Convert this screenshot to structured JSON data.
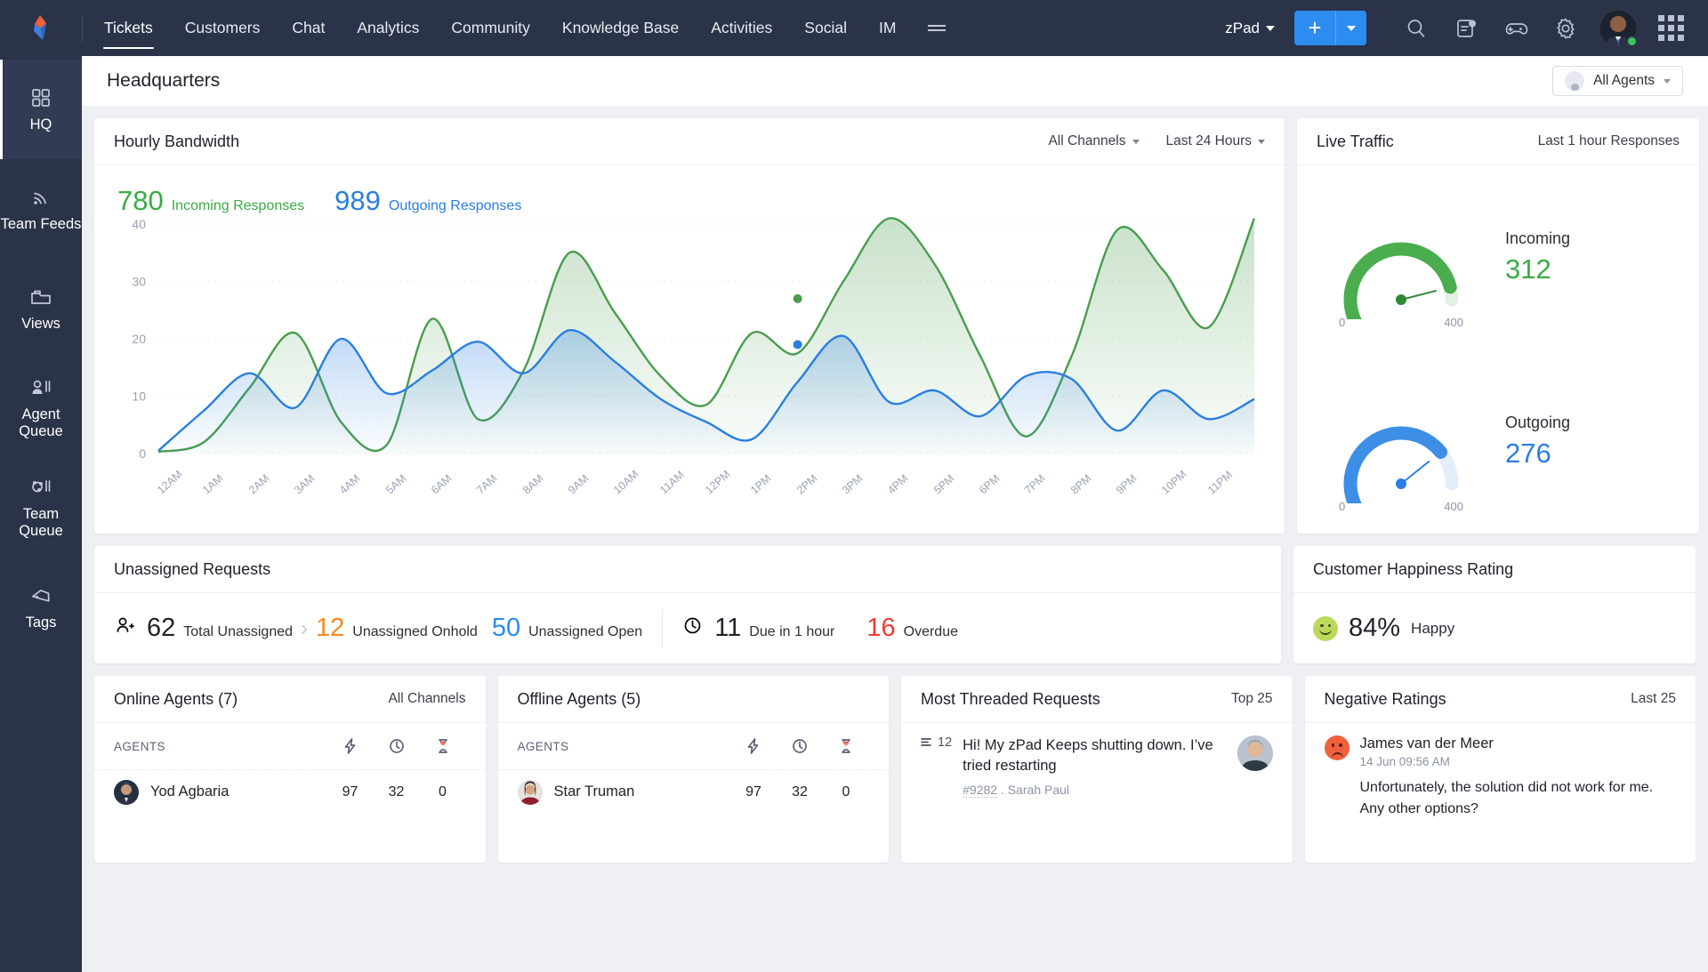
{
  "topnav": {
    "logo": "zoho-desk-logo",
    "items": [
      {
        "label": "Tickets",
        "active": true
      },
      {
        "label": "Customers",
        "active": false
      },
      {
        "label": "Chat",
        "active": false
      },
      {
        "label": "Analytics",
        "active": false
      },
      {
        "label": "Community",
        "active": false
      },
      {
        "label": "Knowledge Base",
        "active": false
      },
      {
        "label": "Activities",
        "active": false
      },
      {
        "label": "Social",
        "active": false
      },
      {
        "label": "IM",
        "active": false
      }
    ],
    "more_icon": "hamburger-icon",
    "department": "zPad",
    "add_button": "+",
    "icons": [
      "search-icon",
      "notes-icon",
      "gamepad-icon",
      "gear-icon",
      "avatar",
      "apps-grid-icon"
    ],
    "status": "online"
  },
  "sidebar": {
    "items": [
      {
        "label": "HQ",
        "icon": "grid-icon",
        "active": true
      },
      {
        "label": "Team Feeds",
        "icon": "feed-icon",
        "active": false
      },
      {
        "label": "Views",
        "icon": "folder-icon",
        "active": false
      },
      {
        "label": "Agent Queue",
        "icon": "agent-queue-icon",
        "active": false
      },
      {
        "label": "Team Queue",
        "icon": "team-queue-icon",
        "active": false
      },
      {
        "label": "Tags",
        "icon": "tag-icon",
        "active": false
      }
    ]
  },
  "page": {
    "title": "Headquarters",
    "agent_filter": "All Agents"
  },
  "bandwidth": {
    "title": "Hourly Bandwidth",
    "channel_filter": "All Channels",
    "time_filter": "Last 24 Hours",
    "incoming_value": "780",
    "incoming_label": "Incoming Responses",
    "outgoing_value": "989",
    "outgoing_label": "Outgoing Responses"
  },
  "chart_data": {
    "type": "line",
    "title": "Hourly Bandwidth",
    "xlabel": "",
    "ylabel": "",
    "ylim": [
      0,
      40
    ],
    "yticks": [
      0,
      10,
      20,
      30,
      40
    ],
    "grid": true,
    "legend_position": "top-left",
    "categories": [
      "12AM",
      "1AM",
      "2AM",
      "3AM",
      "4AM",
      "5AM",
      "6AM",
      "7AM",
      "8AM",
      "9AM",
      "10AM",
      "11AM",
      "12PM",
      "1PM",
      "2PM",
      "3PM",
      "4PM",
      "5PM",
      "6PM",
      "7PM",
      "8PM",
      "9PM",
      "10PM",
      "11PM"
    ],
    "series": [
      {
        "name": "Incoming Responses",
        "color": "#4a9d4f",
        "total": 780,
        "values": [
          0.3,
          2,
          11.5,
          21,
          5.5,
          1.5,
          23.5,
          6,
          14.5,
          35,
          24.5,
          13.5,
          8.5,
          21,
          17.5,
          30,
          41,
          33,
          17,
          3,
          17,
          39,
          32,
          22,
          41
        ]
      },
      {
        "name": "Outgoing Responses",
        "color": "#2a7fe0",
        "total": 989,
        "values": [
          0.5,
          7.5,
          14,
          8,
          20,
          10.5,
          14.5,
          19.5,
          14,
          21.5,
          16,
          9.5,
          5.5,
          2.5,
          12.5,
          20.5,
          9,
          11,
          6.5,
          13.5,
          13,
          4,
          11,
          6,
          9.5
        ]
      }
    ],
    "markers": [
      {
        "series": "Incoming Responses",
        "x": "2PM",
        "y": 27
      },
      {
        "series": "Outgoing Responses",
        "x": "2PM",
        "y": 19
      }
    ]
  },
  "live_traffic": {
    "title": "Live Traffic",
    "subtitle": "Last 1 hour Responses",
    "gauges": [
      {
        "label": "Incoming",
        "value": "312",
        "min": "0",
        "max": "400",
        "color": "#4aae4f"
      },
      {
        "label": "Outgoing",
        "value": "276",
        "min": "0",
        "max": "400",
        "color": "#3d8ee6"
      }
    ]
  },
  "unassigned": {
    "title": "Unassigned Requests",
    "stats": [
      {
        "icon": "add-user-icon",
        "value": "62",
        "label": "Total Unassigned",
        "color": "#20232b"
      },
      {
        "icon": "",
        "value": "12",
        "label": "Unassigned Onhold",
        "color": "#f7881f"
      },
      {
        "icon": "",
        "value": "50",
        "label": "Unassigned Open",
        "color": "#2a8ced"
      },
      {
        "icon": "clock-icon",
        "value": "11",
        "label": "Due in 1 hour",
        "color": "#20232b"
      },
      {
        "icon": "",
        "value": "16",
        "label": "Overdue",
        "color": "#ee3b33"
      }
    ]
  },
  "happiness": {
    "title": "Customer Happiness Rating",
    "value": "84%",
    "label": "Happy"
  },
  "online_agents": {
    "title": "Online Agents (7)",
    "filter": "All Channels",
    "col_agents": "AGENTS",
    "cols": [
      "lightning-icon",
      "clock-icon",
      "hourglass-icon"
    ],
    "rows": [
      {
        "name": "Yod Agbaria",
        "v1": "97",
        "v2": "32",
        "v3": "0"
      }
    ]
  },
  "offline_agents": {
    "title": "Offline Agents (5)",
    "filter": "",
    "col_agents": "AGENTS",
    "cols": [
      "lightning-icon",
      "clock-icon",
      "hourglass-icon"
    ],
    "rows": [
      {
        "name": "Star Truman",
        "v1": "97",
        "v2": "32",
        "v3": "0"
      }
    ]
  },
  "threaded": {
    "title": "Most Threaded Requests",
    "filter": "Top 25",
    "rows": [
      {
        "count": "12",
        "text": "Hi! My zPad Keeps shutting down. I’ve tried restarting",
        "id": "#9282",
        "sep": ".",
        "author": "Sarah Paul"
      }
    ]
  },
  "negative": {
    "title": "Negative Ratings",
    "filter": "Last 25",
    "rows": [
      {
        "name": "James van der Meer",
        "date": "14 Jun 09:56 AM",
        "body": "Unfortunately, the solution did not work for me. Any other options?"
      }
    ]
  }
}
